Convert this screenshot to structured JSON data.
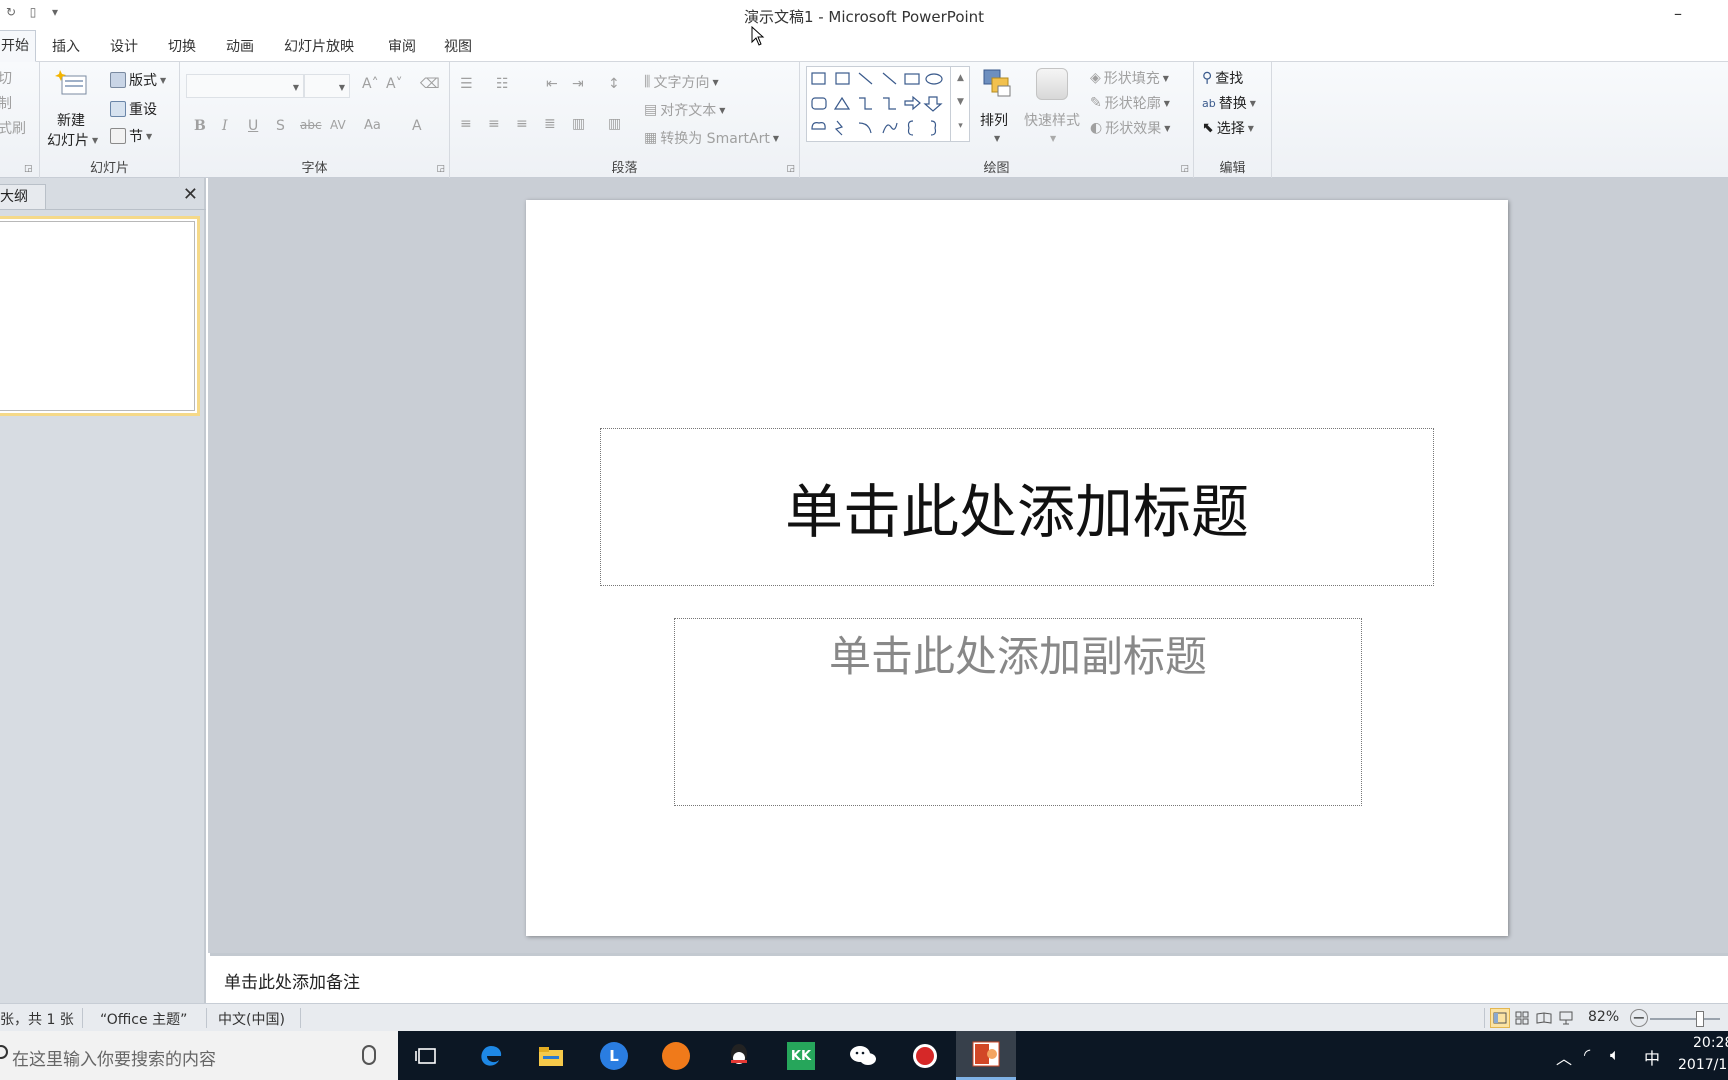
{
  "app": {
    "window_title": "演示文稿1 - Microsoft PowerPoint",
    "minimize_glyph": "–"
  },
  "ribbon_tabs": [
    "开始",
    "插入",
    "设计",
    "切换",
    "动画",
    "幻灯片放映",
    "审阅",
    "视图"
  ],
  "ribbon": {
    "clipboard": {
      "cut": "切",
      "copy": "制",
      "format_painter": "式刷"
    },
    "slides": {
      "new_slide_line1": "新建",
      "new_slide_line2": "幻灯片",
      "layout": "版式",
      "reset": "重设",
      "section": "节",
      "label": "幻灯片"
    },
    "font": {
      "bold": "B",
      "italic": "I",
      "underline": "U",
      "shadow": "S",
      "strikethrough": "abc",
      "spacing": "AV",
      "change_case": "Aa",
      "font_color": "A",
      "grow": "A˄",
      "shrink": "A˅",
      "label": "字体"
    },
    "paragraph": {
      "text_direction": "文字方向",
      "align_text": "对齐文本",
      "convert_smartart": "转换为 SmartArt",
      "label": "段落"
    },
    "drawing": {
      "arrange": "排列",
      "quick_styles": "快速样式",
      "shape_fill": "形状填充",
      "shape_outline": "形状轮廓",
      "shape_effects": "形状效果",
      "label": "绘图"
    },
    "editing": {
      "find": "查找",
      "replace": "替换",
      "select": "选择",
      "label": "编辑"
    }
  },
  "left_panel": {
    "outline_tab": "大纲",
    "close_glyph": "✕"
  },
  "slide": {
    "title_placeholder": "单击此处添加标题",
    "subtitle_placeholder": "单击此处添加副标题"
  },
  "notes": {
    "placeholder": "单击此处添加备注"
  },
  "statusbar": {
    "slide_count": "张，共 1 张",
    "theme": "“Office 主题”",
    "language": "中文(中国)",
    "zoom": "82%",
    "zoom_out": "−"
  },
  "taskbar": {
    "search_placeholder": "在这里输入你要搜索的内容",
    "kk_label": "KK",
    "l_label": "L",
    "ime": "中",
    "time": "20:28",
    "date": "2017/1"
  },
  "colors": {
    "ribbon_bg": "#eef1f5",
    "edit_area_bg": "#c9ced5",
    "taskbar_bg": "#0c1724",
    "selected_thumb_border": "#f5d989"
  }
}
